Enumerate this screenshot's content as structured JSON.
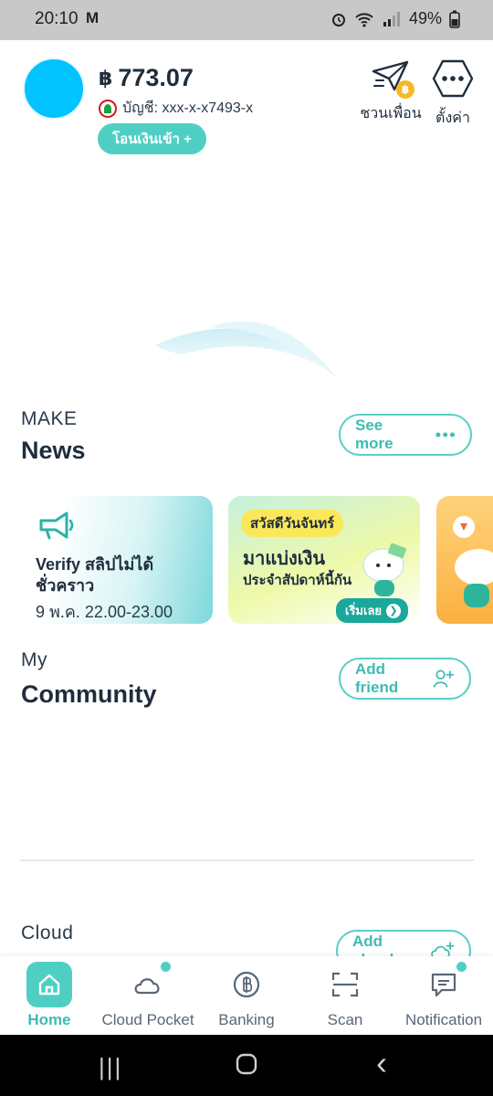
{
  "status_bar": {
    "time": "20:10",
    "mail_icon": "M",
    "battery": "49%"
  },
  "header": {
    "currency": "฿",
    "balance": "773.07",
    "account": "บัญชี: xxx-x-x7493-x",
    "transfer_label": "โอนเงินเข้า +",
    "invite_label": "ชวนเพื่อน",
    "invite_coin": "฿",
    "settings_label": "ตั้งค่า"
  },
  "news": {
    "small": "MAKE",
    "title": "News",
    "see_more": "See more",
    "cards": [
      {
        "line1": "Verify สลิปไม่ได้ชั่วคราว",
        "line2": "9 พ.ค. 22.00-23.00"
      },
      {
        "tag": "สวัสดีวันจันทร์",
        "head1": "มาแบ่งเงิน",
        "head2": "ประจำสัปดาห์นี้กัน",
        "cta": "เริ่มเลย",
        "cta_arrow": "❯"
      }
    ]
  },
  "community": {
    "small": "My",
    "title": "Community",
    "add_friend": "Add friend"
  },
  "cloud": {
    "small": "Cloud",
    "add_cloud": "Add cloud"
  },
  "bottom_nav": [
    {
      "label": "Home",
      "icon": "home-icon",
      "active": true
    },
    {
      "label": "Cloud Pocket",
      "icon": "cloud-icon",
      "badge": true
    },
    {
      "label": "Banking",
      "icon": "baht-icon"
    },
    {
      "label": "Scan",
      "icon": "scan-icon"
    },
    {
      "label": "Notification",
      "icon": "chat-icon",
      "badge": true
    }
  ],
  "system_nav": {
    "recents": "|||",
    "back": "‹"
  },
  "colors": {
    "accent": "#4fcfc4",
    "avatar": "#00c3ff",
    "coin": "#f6b728"
  }
}
